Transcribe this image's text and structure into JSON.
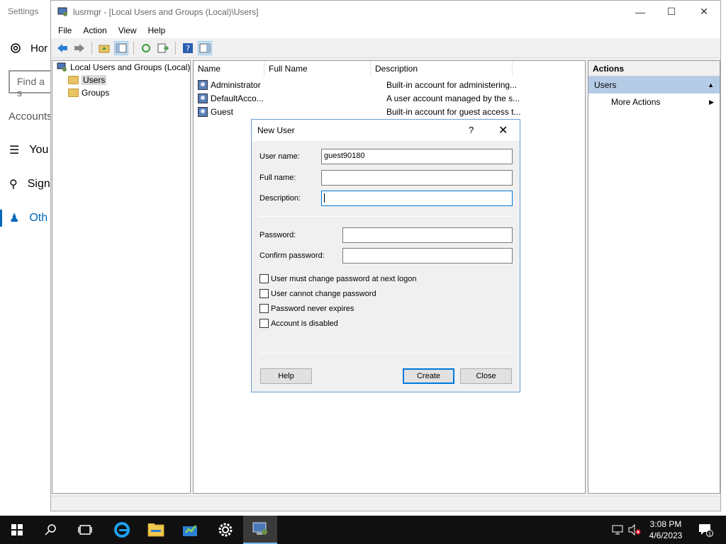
{
  "settings": {
    "title": "Settings",
    "home": "Hor",
    "search_placeholder": "Find a s",
    "section": "Accounts",
    "nav": [
      {
        "label": "You"
      },
      {
        "label": "Sign"
      },
      {
        "label": "Oth"
      }
    ]
  },
  "window": {
    "title": "lusrmgr - [Local Users and Groups (Local)\\Users]",
    "menu": [
      "File",
      "Action",
      "View",
      "Help"
    ]
  },
  "tree": {
    "root": "Local Users and Groups (Local)",
    "children": [
      "Users",
      "Groups"
    ]
  },
  "list": {
    "columns": [
      "Name",
      "Full Name",
      "Description"
    ],
    "rows": [
      {
        "name": "Administrator",
        "full_name": "",
        "description": "Built-in account for administering..."
      },
      {
        "name": "DefaultAcco...",
        "full_name": "",
        "description": "A user account managed by the s..."
      },
      {
        "name": "Guest",
        "full_name": "",
        "description": "Built-in account for guest access t..."
      }
    ]
  },
  "actions": {
    "header": "Actions",
    "section": "Users",
    "more": "More Actions"
  },
  "dialog": {
    "title": "New User",
    "help_glyph": "?",
    "fields": {
      "username_label": "User name:",
      "username_value": "guest90180",
      "fullname_label": "Full name:",
      "fullname_value": "",
      "description_label": "Description:",
      "description_value": "",
      "password_label": "Password:",
      "confirm_label": "Confirm password:"
    },
    "checkboxes": [
      {
        "label": "User must change password at next logon",
        "checked": false
      },
      {
        "label": "User cannot change password",
        "checked": false
      },
      {
        "label": "Password never expires",
        "checked": false
      },
      {
        "label": "Account is disabled",
        "checked": false
      }
    ],
    "buttons": {
      "help": "Help",
      "create": "Create",
      "close": "Close"
    }
  },
  "taskbar": {
    "time": "3:08 PM",
    "date": "4/6/2023",
    "notification_count": "1"
  },
  "colors": {
    "accent": "#0067b8",
    "actions_selected": "#b5cce6",
    "taskbar": "#101010"
  }
}
